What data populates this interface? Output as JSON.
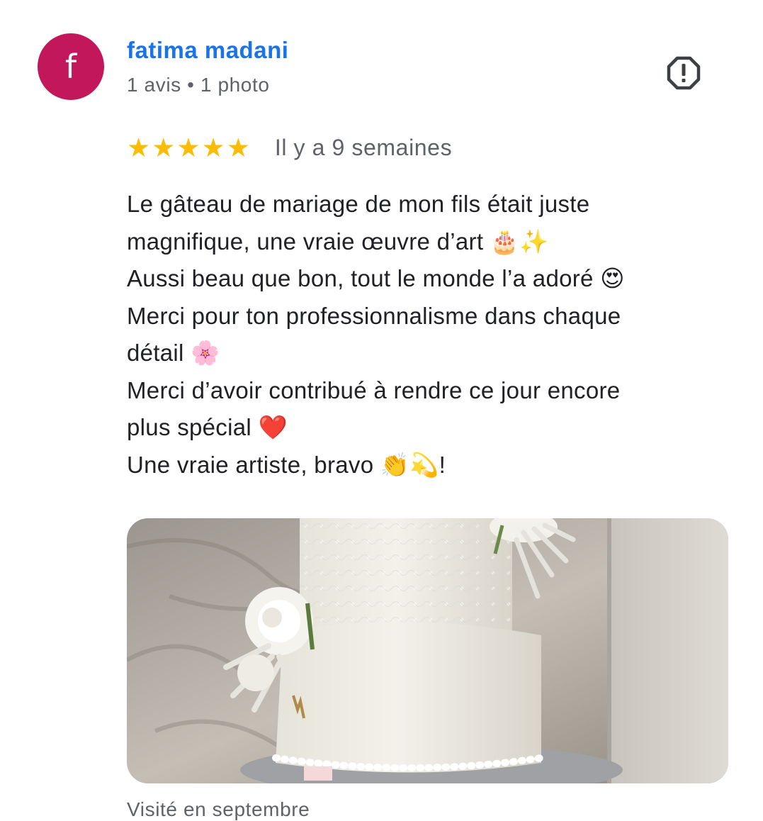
{
  "review": {
    "author": {
      "name": "fatima madani",
      "initial": "f",
      "meta": "1 avis • 1 photo",
      "avatar_color": "#c2185b",
      "name_color": "#1a73e8"
    },
    "report_icon": "report-flag-icon",
    "rating": {
      "value": 5,
      "max": 5,
      "star_color": "#fbbc04"
    },
    "date": "Il y a 9 semaines",
    "text_lines": [
      "Le gâteau de mariage de mon fils était juste",
      "magnifique, une vraie œuvre d’art 🎂✨",
      "Aussi beau que bon, tout le monde l’a adoré 😍",
      "Merci pour ton professionnalisme dans chaque",
      "détail 🌸",
      "Merci d’avoir contribué à rendre ce jour encore",
      "plus spécial ❤️",
      "Une vraie artiste, bravo 👏💫!"
    ],
    "photo": {
      "subject": "white-tiered-wedding-cake"
    },
    "visited": "Visité en septembre"
  }
}
